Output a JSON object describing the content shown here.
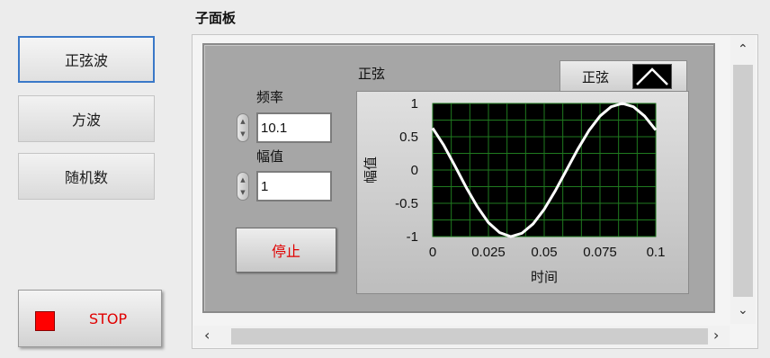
{
  "left_buttons": [
    {
      "label": "正弦波",
      "active": true
    },
    {
      "label": "方波",
      "active": false
    },
    {
      "label": "随机数",
      "active": false
    }
  ],
  "stop_button": {
    "label": "STOP"
  },
  "subpanel": {
    "title": "子面板",
    "frequency": {
      "label": "频率",
      "value": "10.1"
    },
    "amplitude": {
      "label": "幅值",
      "value": "1"
    },
    "stop_small_label": "停止",
    "graph": {
      "label": "正弦",
      "legend_name": "正弦"
    }
  },
  "chart_data": {
    "type": "line",
    "title": "",
    "xlabel": "时间",
    "ylabel": "幅值",
    "xlim": [
      0,
      0.1
    ],
    "ylim": [
      -1,
      1
    ],
    "x_ticks": [
      "0",
      "0.025",
      "0.05",
      "0.075",
      "0.1"
    ],
    "y_ticks": [
      "1",
      "0.5",
      "0",
      "-0.5",
      "-1"
    ],
    "grid": true,
    "background": "#000000",
    "grid_color": "#1f7a1f",
    "series": [
      {
        "color": "#ffffff",
        "x": [
          0,
          0.005,
          0.01,
          0.015,
          0.02,
          0.025,
          0.03,
          0.035,
          0.04,
          0.045,
          0.05,
          0.055,
          0.06,
          0.065,
          0.07,
          0.075,
          0.08,
          0.085,
          0.09,
          0.095,
          0.1
        ],
        "y": [
          0.63,
          0.37,
          0.06,
          -0.26,
          -0.55,
          -0.79,
          -0.94,
          -1.0,
          -0.95,
          -0.81,
          -0.59,
          -0.31,
          0.0,
          0.31,
          0.59,
          0.81,
          0.95,
          1.0,
          0.95,
          0.81,
          0.6
        ]
      }
    ]
  },
  "colors": {
    "accent": "#3a78c8",
    "stop_led": "#ff0000",
    "stop_text": "#e00000"
  },
  "icons": {
    "scroll_up": "▲",
    "scroll_down": "▼",
    "scroll_left": "◀",
    "scroll_right": "▶",
    "spin_up": "▲",
    "spin_down": "▼"
  }
}
